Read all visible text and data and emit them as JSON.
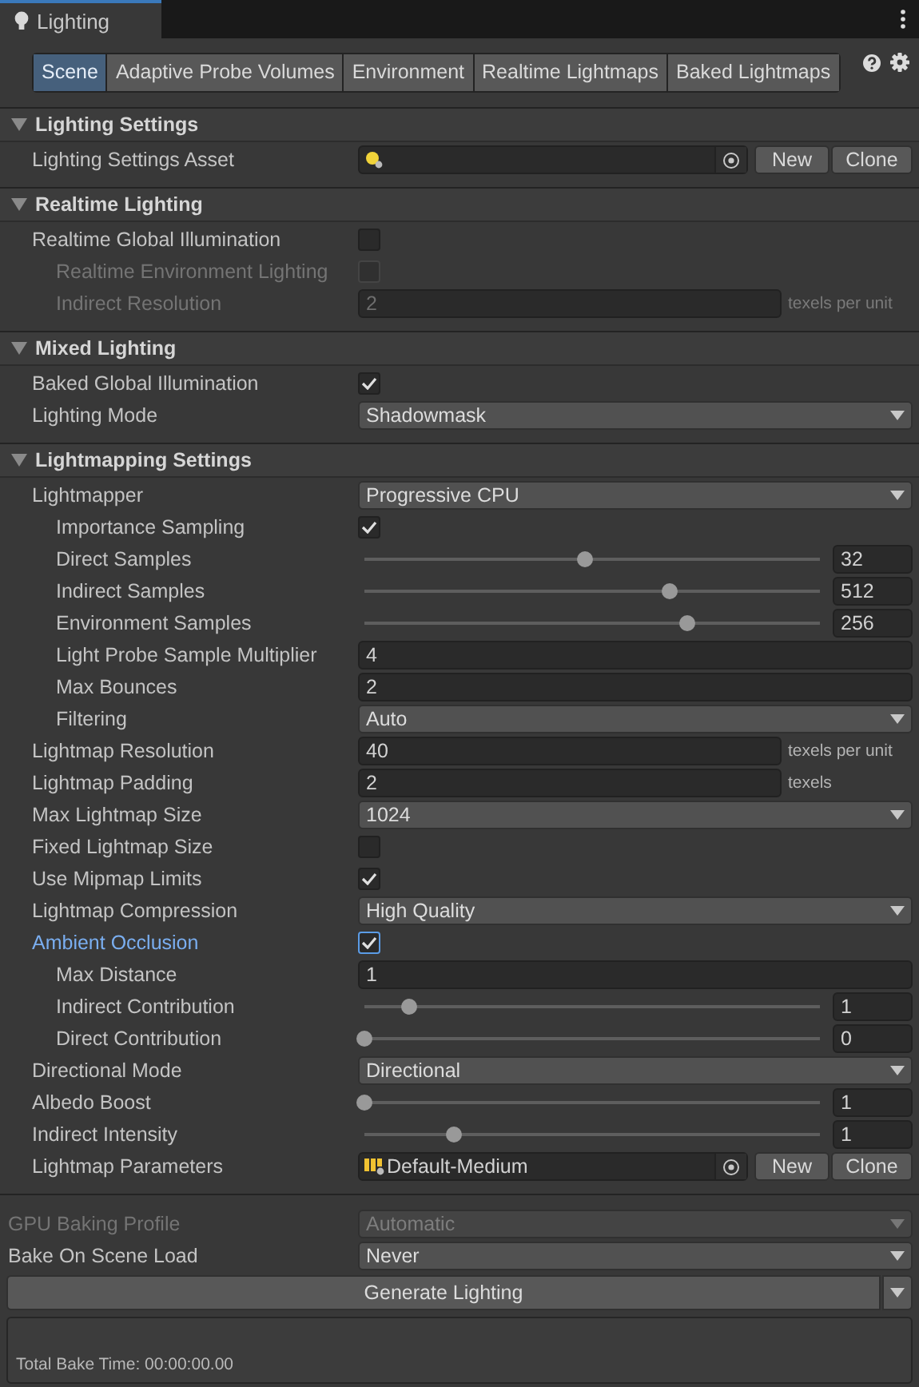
{
  "window_tab": {
    "title": "Lighting"
  },
  "tabs": [
    {
      "label": "Scene",
      "selected": true
    },
    {
      "label": "Adaptive Probe Volumes",
      "selected": false
    },
    {
      "label": "Environment",
      "selected": false
    },
    {
      "label": "Realtime Lightmaps",
      "selected": false
    },
    {
      "label": "Baked Lightmaps",
      "selected": false
    }
  ],
  "sections": [
    {
      "title": "Lighting Settings",
      "expanded": true,
      "rows": [
        {
          "label": "Lighting Settings Asset",
          "kind": "object",
          "disabled": false,
          "focused": false,
          "buttons": [
            "New",
            "Clone"
          ]
        }
      ]
    },
    {
      "title": "Realtime Lighting",
      "expanded": true,
      "rows": [
        {
          "label": "Realtime Global Illumination",
          "kind": "checkbox",
          "checked": false,
          "disabled": false,
          "focused": false,
          "children": [
            {
              "label": "Realtime Environment Lighting",
              "kind": "checkbox",
              "checked": false,
              "disabled": true,
              "focused": false
            },
            {
              "label": "Indirect Resolution",
              "kind": "field",
              "value": "2",
              "suffix": "texels per unit",
              "disabled": true,
              "focused": false
            }
          ]
        }
      ]
    },
    {
      "title": "Mixed Lighting",
      "expanded": true,
      "rows": [
        {
          "label": "Baked Global Illumination",
          "kind": "checkbox",
          "checked": true,
          "disabled": false,
          "focused": false
        },
        {
          "label": "Lighting Mode",
          "kind": "dropdown",
          "value": "Shadowmask",
          "disabled": false,
          "focused": false
        }
      ]
    },
    {
      "title": "Lightmapping Settings",
      "expanded": true,
      "rows": [
        {
          "label": "Lightmapper",
          "kind": "dropdown",
          "value": "Progressive CPU",
          "disabled": false,
          "focused": false,
          "children": [
            {
              "label": "Importance Sampling",
              "kind": "checkbox",
              "checked": true,
              "disabled": false,
              "focused": false
            },
            {
              "label": "Direct Samples",
              "kind": "slider",
              "level": 0.49,
              "value": "32",
              "disabled": false,
              "focused": false
            },
            {
              "label": "Indirect Samples",
              "kind": "slider",
              "level": 0.68,
              "value": "512",
              "disabled": false,
              "focused": false
            },
            {
              "label": "Environment Samples",
              "kind": "slider",
              "level": 0.72,
              "value": "256",
              "disabled": false,
              "focused": false
            },
            {
              "label": "Light Probe Sample Multiplier",
              "kind": "field",
              "value": "4",
              "disabled": false,
              "focused": false
            },
            {
              "label": "Max Bounces",
              "kind": "field",
              "value": "2",
              "disabled": false,
              "focused": false
            },
            {
              "label": "Filtering",
              "kind": "dropdown",
              "value": "Auto",
              "disabled": false,
              "focused": false
            }
          ]
        },
        {
          "label": "Lightmap Resolution",
          "kind": "field",
          "value": "40",
          "suffix": "texels per unit",
          "disabled": false,
          "focused": false
        },
        {
          "label": "Lightmap Padding",
          "kind": "field",
          "value": "2",
          "suffix": "texels",
          "disabled": false,
          "focused": false
        },
        {
          "label": "Max Lightmap Size",
          "kind": "dropdown",
          "value": "1024",
          "disabled": false,
          "focused": false
        },
        {
          "label": "Fixed Lightmap Size",
          "kind": "checkbox",
          "checked": false,
          "disabled": false,
          "focused": false
        },
        {
          "label": "Use Mipmap Limits",
          "kind": "checkbox",
          "checked": true,
          "disabled": false,
          "focused": false
        },
        {
          "label": "Lightmap Compression",
          "kind": "dropdown",
          "value": "High Quality",
          "disabled": false,
          "focused": false
        },
        {
          "label": "Ambient Occlusion",
          "kind": "checkbox",
          "checked": true,
          "disabled": false,
          "focused": true,
          "children": [
            {
              "label": "Max Distance",
              "kind": "field",
              "value": "1",
              "disabled": false,
              "focused": false
            },
            {
              "label": "Indirect Contribution",
              "kind": "slider",
              "level": 0.1,
              "value": "1",
              "disabled": false,
              "focused": false
            },
            {
              "label": "Direct Contribution",
              "kind": "slider",
              "level": 0,
              "value": "0",
              "disabled": false,
              "focused": false
            }
          ]
        },
        {
          "label": "Directional Mode",
          "kind": "dropdown",
          "value": "Directional",
          "disabled": false,
          "focused": false
        },
        {
          "label": "Albedo Boost",
          "kind": "slider",
          "level": 0,
          "value": "1",
          "disabled": false,
          "focused": false
        },
        {
          "label": "Indirect Intensity",
          "kind": "slider",
          "level": 0.2,
          "value": "1",
          "disabled": false,
          "focused": false
        },
        {
          "label": "Lightmap Parameters",
          "kind": "object",
          "value": "Default-Medium",
          "buttons": [
            "New",
            "Clone"
          ],
          "disabled": false,
          "focused": false
        }
      ]
    }
  ],
  "footer_rows": [
    {
      "label": "GPU Baking Profile",
      "kind": "dropdown",
      "value": "Automatic",
      "disabled": true,
      "focused": false
    },
    {
      "label": "Bake On Scene Load",
      "kind": "dropdown",
      "value": "Never",
      "disabled": false,
      "focused": false
    }
  ],
  "generate_button": "Generate Lighting",
  "bake_time": "Total Bake Time: 00:00:00.00"
}
